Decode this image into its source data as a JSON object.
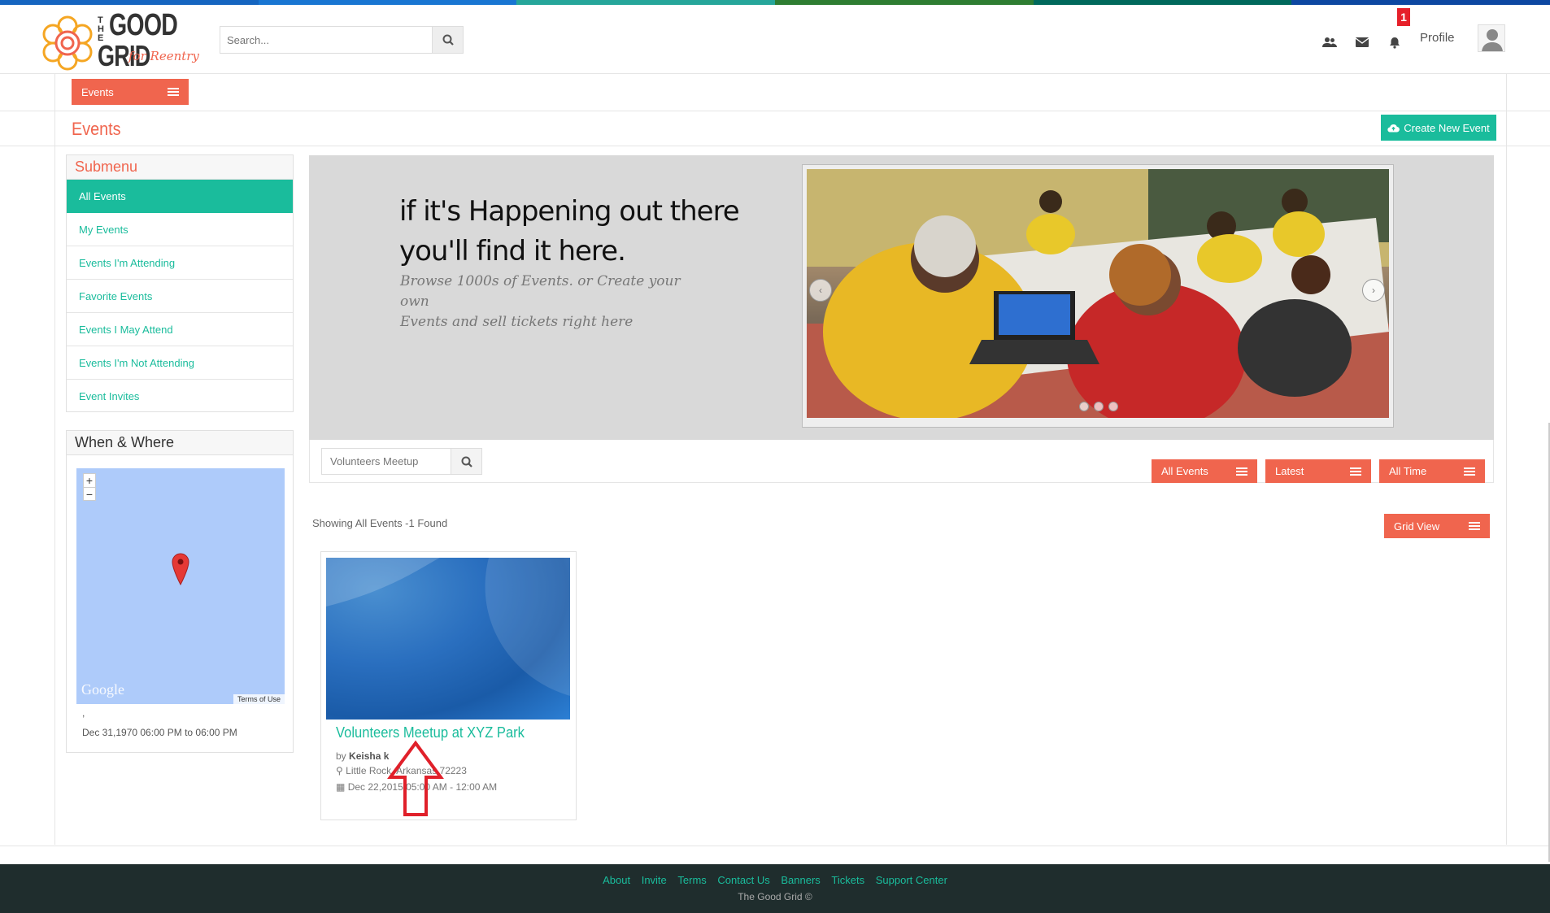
{
  "colors": {
    "accent": "#f0654e",
    "teal": "#1abc9c",
    "footer_bg": "#1f2d2d",
    "badge": "#e6202a"
  },
  "top_stripe_colors": [
    "#1565c0",
    "#1976d2",
    "#26a69a",
    "#2e7d32",
    "#00695c",
    "#0d47a1"
  ],
  "logo": {
    "word_the": "THE",
    "word_good": "GOOD",
    "word_grid": "GRID",
    "tagline": "for Reentry",
    "icon": "flower-logo-icon"
  },
  "header": {
    "search_placeholder": "Search...",
    "search_icon": "search-icon",
    "icons": [
      "users-icon",
      "envelope-icon",
      "bell-icon"
    ],
    "notification_count": "1",
    "profile_label": "Profile"
  },
  "section_button": "Events",
  "page_title": "Events",
  "create_button": "Create New Event",
  "submenu": {
    "title": "Submenu",
    "items": [
      {
        "label": "All Events",
        "active": true
      },
      {
        "label": "My Events"
      },
      {
        "label": "Events I'm Attending"
      },
      {
        "label": "Favorite Events"
      },
      {
        "label": "Events I May Attend"
      },
      {
        "label": "Events I'm Not Attending"
      },
      {
        "label": "Event Invites"
      }
    ]
  },
  "when_where": {
    "title": "When & Where",
    "map_google": "Google",
    "map_terms": "Terms of Use",
    "comma": ",",
    "date": "Dec 31,1970 06:00 PM to 06:00 PM"
  },
  "hero": {
    "line1": "if it's Happening out there",
    "line2": "you'll find it here.",
    "sub1": "Browse 1000s of Events. or Create your own",
    "sub2": "Events and sell tickets right here"
  },
  "filter": {
    "search_value": "Volunteers Meetup",
    "buttons": [
      "All Events",
      "Latest",
      "All Time"
    ]
  },
  "results": {
    "showing": "Showing All Events -1 Found",
    "view_button": "Grid View"
  },
  "event": {
    "title": "Volunteers Meetup at XYZ Park",
    "by": "by",
    "author": "Keisha k",
    "location": "Little Rock, Arkansas 72223",
    "date": "Dec 22,2015 05:00 AM - 12:00 AM"
  },
  "footer": {
    "links": [
      "About",
      "Invite",
      "Terms",
      "Contact Us",
      "Banners",
      "Tickets",
      "Support Center"
    ],
    "copyright": "The Good Grid ©"
  }
}
